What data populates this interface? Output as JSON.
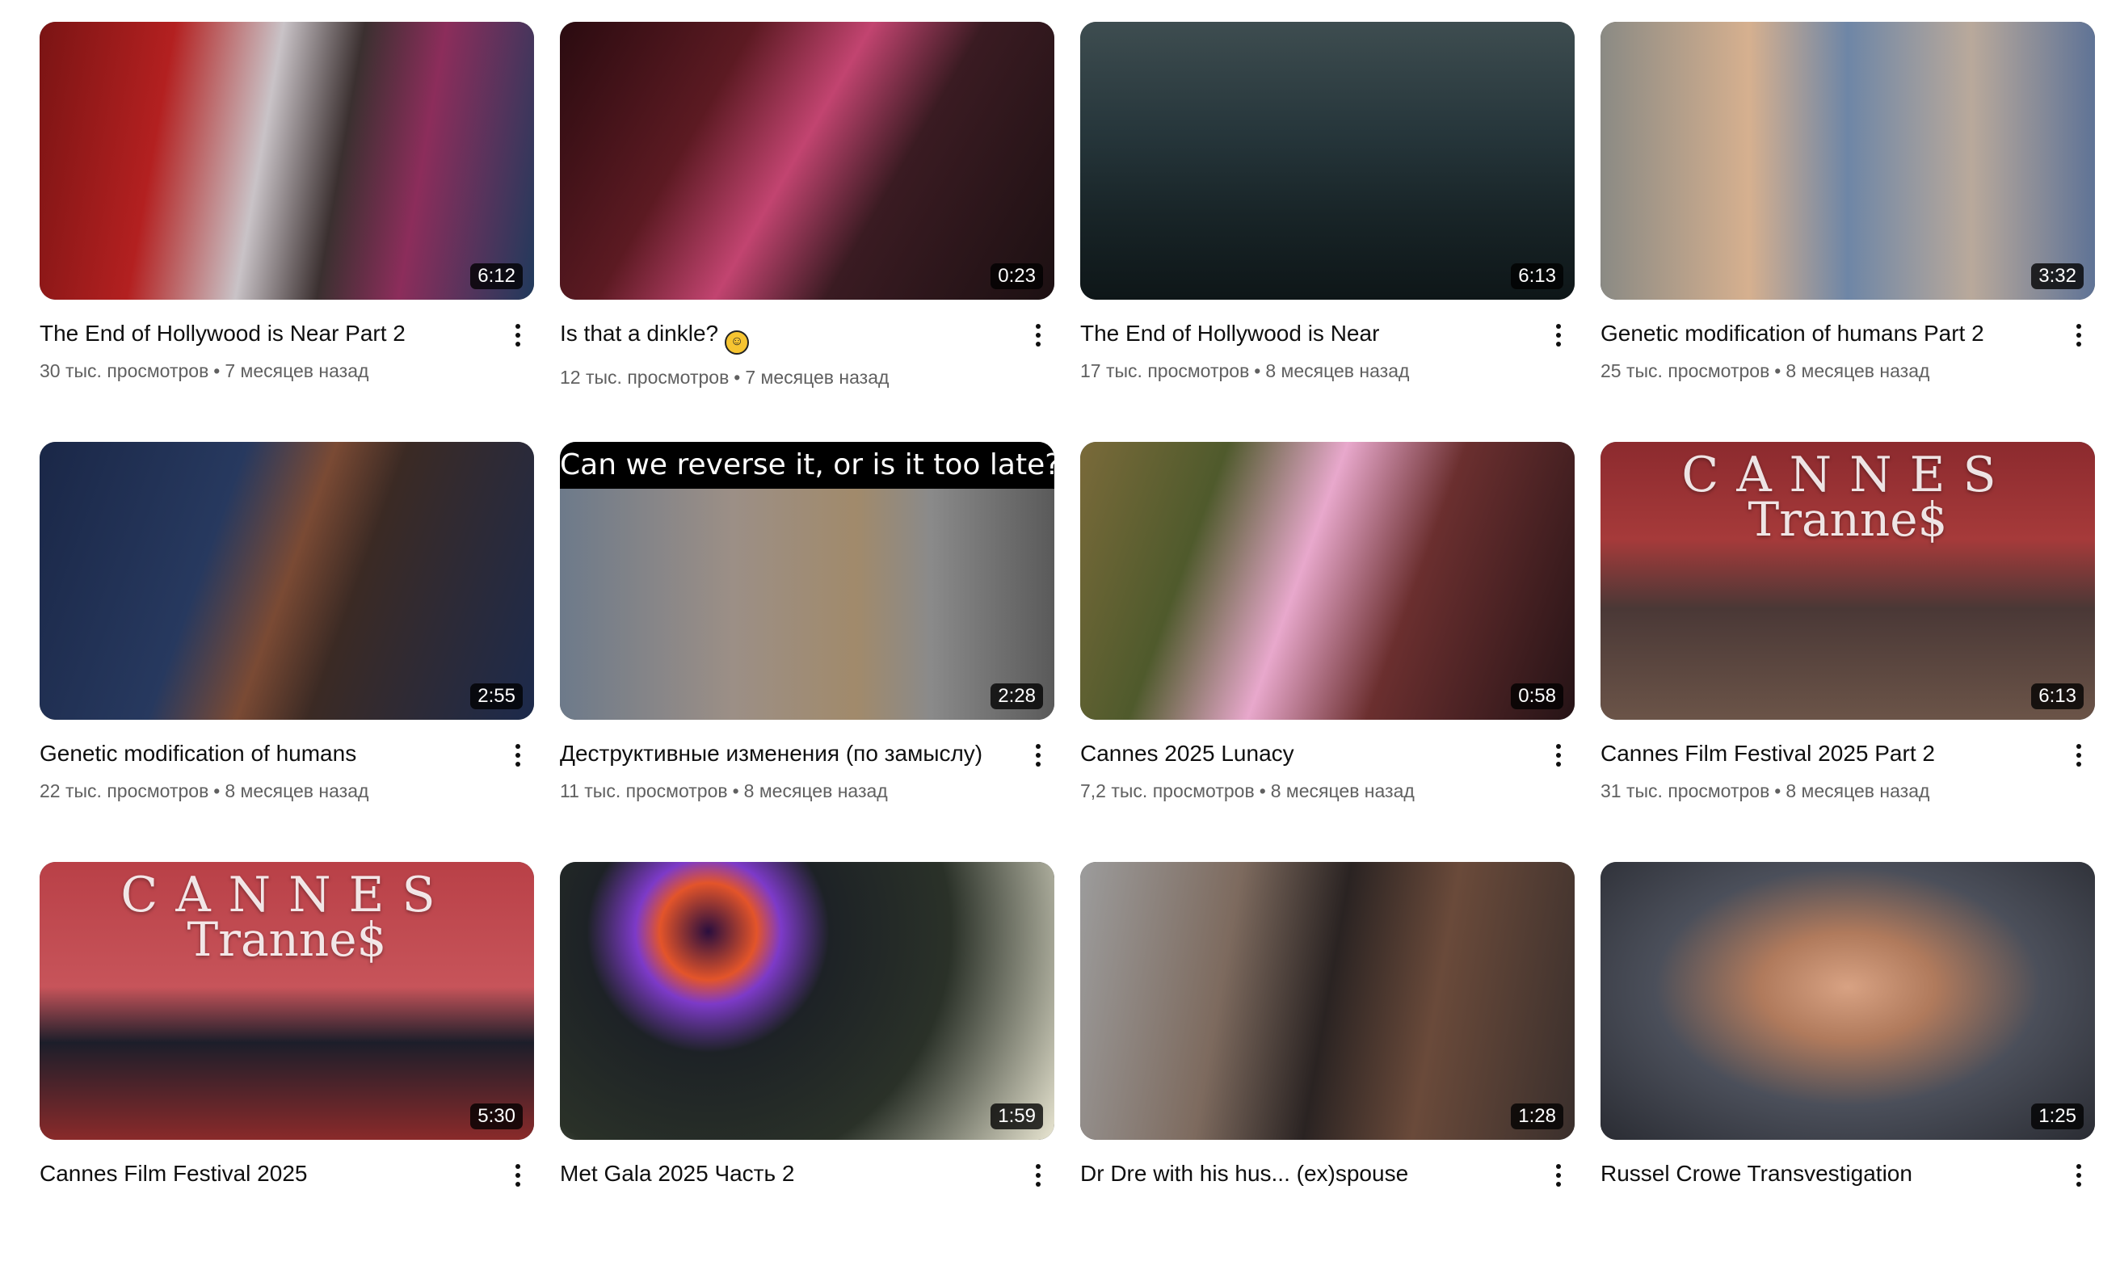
{
  "videos": [
    {
      "title": "The End of Hollywood is Near Part 2",
      "views": "30 тыс. просмотров",
      "age": "7 месяцев назад",
      "duration": "6:12",
      "bg": "linear-gradient(100deg,#7a1414 0%,#b32020 25%,#c9c3c7 45%,#3b3030 60%,#8c2d5b 75%,#203a5c 100%)",
      "overlay_caption": "",
      "overlay_big": "",
      "overlay_sub": ""
    },
    {
      "title": "Is that a dinkle?",
      "emoji": "☺",
      "views": "12 тыс. просмотров",
      "age": "7 месяцев назад",
      "duration": "0:23",
      "bg": "linear-gradient(120deg,#2a0b10 0%,#5c1a22 30%,#c24470 48%,#3a1b22 65%,#1c1012 100%)",
      "overlay_caption": "",
      "overlay_big": "",
      "overlay_sub": ""
    },
    {
      "title": "The End of Hollywood is Near",
      "views": "17 тыс. просмотров",
      "age": "8 месяцев назад",
      "duration": "6:13",
      "bg": "linear-gradient(180deg,#3e4d50 0%,#26363b 40%,#182427 70%,#0e1618 100%)",
      "overlay_caption": "",
      "overlay_big": "",
      "overlay_sub": ""
    },
    {
      "title": "Genetic modification of humans Part 2",
      "views": "25 тыс. просмотров",
      "age": "8 месяцев назад",
      "duration": "3:32",
      "bg": "linear-gradient(90deg,#8a8a84 0%,#d6b08f 30%,#6e86a6 50%,#b9a99b 75%,#5f7396 100%)",
      "overlay_caption": "",
      "overlay_big": "",
      "overlay_sub": ""
    },
    {
      "title": "Genetic modification of humans",
      "views": "22 тыс. просмотров",
      "age": "8 месяцев назад",
      "duration": "2:55",
      "bg": "linear-gradient(110deg,#1a2747 0%,#27395f 35%,#7a4a34 50%,#3b2a24 62%,#1c2a4c 100%)",
      "overlay_caption": "",
      "overlay_big": "",
      "overlay_sub": ""
    },
    {
      "title": "Деструктивные изменения (по замыслу)",
      "views": "11 тыс. просмотров",
      "age": "8 месяцев назад",
      "duration": "2:28",
      "bg": "linear-gradient(90deg,#6d7a8a 0%,#9c8f86 35%,#a18a6b 60%,#8a8a8a 75%,#5a5a5a 100%)",
      "overlay_caption": "Can we reverse it, or is it too late?",
      "overlay_big": "",
      "overlay_sub": ""
    },
    {
      "title": "Cannes 2025 Lunacy",
      "views": "7,2 тыс. просмотров",
      "age": "8 месяцев назад",
      "duration": "0:58",
      "bg": "linear-gradient(110deg,#7a6a3a 0%,#4f5a2c 25%,#e8a8cc 45%,#6b2f2f 65%,#251316 100%)",
      "overlay_caption": "",
      "overlay_big": "",
      "overlay_sub": ""
    },
    {
      "title": "Cannes Film Festival 2025 Part 2",
      "views": "31 тыс. просмотров",
      "age": "8 месяцев назад",
      "duration": "6:13",
      "bg": "linear-gradient(180deg,#8c2a2e 0%,#a63a3a 35%,#4a3836 60%,#6b5448 100%)",
      "overlay_caption": "",
      "overlay_big": "Tranne$",
      "overlay_sub": "CANNES"
    },
    {
      "title": "Cannes Film Festival 2025",
      "views": "",
      "age": "",
      "duration": "5:30",
      "bg": "linear-gradient(180deg,#b94047 0%,#c7545a 45%,#1c1e2a 65%,#8a2a2a 100%)",
      "overlay_caption": "",
      "overlay_big": "Tranne$",
      "overlay_sub": "CANNES"
    },
    {
      "title": "Met Gala 2025 Часть 2",
      "views": "",
      "age": "",
      "duration": "1:59",
      "bg": "radial-gradient(circle at 30% 25%,#2a0e3e 0%,#e3542a 12%,#7d3ac8 18%,#1d2226 30%,#2a3128 60%,#e9e6d2 100%)",
      "overlay_caption": "",
      "overlay_big": "",
      "overlay_sub": ""
    },
    {
      "title": "Dr Dre with his hus... (ex)spouse",
      "views": "",
      "age": "",
      "duration": "1:28",
      "bg": "linear-gradient(100deg,#9c9c9c 0%,#7d6a5e 30%,#2a2322 50%,#6a4a3a 70%,#3a2f2c 100%)",
      "overlay_caption": "",
      "overlay_big": "",
      "overlay_sub": ""
    },
    {
      "title": "Russel Crowe Transvestigation",
      "views": "",
      "age": "",
      "duration": "1:25",
      "bg": "radial-gradient(ellipse at 50% 45%,#d8a283 0%,#b07a5c 25%,#4b4f5a 55%,#2a2c33 100%)",
      "overlay_caption": "",
      "overlay_big": "",
      "overlay_sub": ""
    }
  ]
}
